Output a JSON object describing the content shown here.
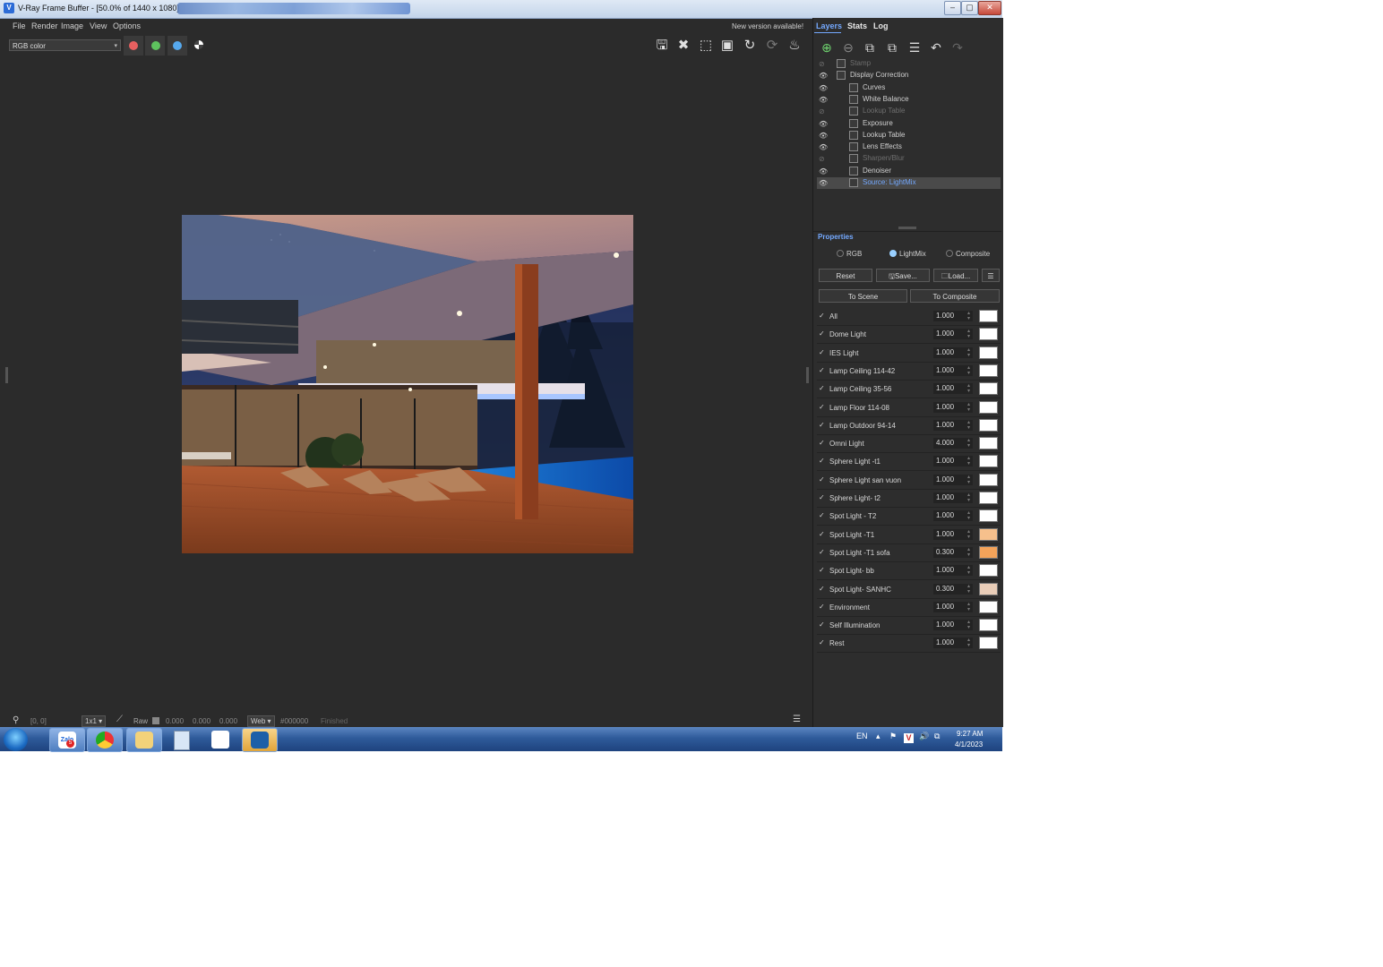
{
  "window": {
    "title": "V-Ray Frame Buffer - [50.0% of 1440 x 1080]",
    "controls": [
      "–",
      "▢",
      "✕"
    ]
  },
  "menu": [
    "File",
    "Render",
    "Image",
    "View",
    "Options"
  ],
  "notice": "New version available!",
  "toolbar": {
    "channel": "RGB color",
    "channel_colors": {
      "red": "#e86060",
      "green": "#5ec25e",
      "blue": "#56a9ee"
    }
  },
  "right_tabs": [
    "Layers",
    "Stats",
    "Log"
  ],
  "layers": [
    {
      "name": "Stamp",
      "indent": 0,
      "enabled": false,
      "selected": false
    },
    {
      "name": "Display Correction",
      "indent": 0,
      "enabled": true,
      "selected": false
    },
    {
      "name": "Curves",
      "indent": 1,
      "enabled": true,
      "selected": false
    },
    {
      "name": "White Balance",
      "indent": 1,
      "enabled": true,
      "selected": false
    },
    {
      "name": "Lookup Table",
      "indent": 1,
      "enabled": false,
      "selected": false
    },
    {
      "name": "Exposure",
      "indent": 1,
      "enabled": true,
      "selected": false
    },
    {
      "name": "Lookup Table",
      "indent": 1,
      "enabled": true,
      "selected": false
    },
    {
      "name": "Lens Effects",
      "indent": 1,
      "enabled": true,
      "selected": false
    },
    {
      "name": "Sharpen/Blur",
      "indent": 1,
      "enabled": false,
      "selected": false
    },
    {
      "name": "Denoiser",
      "indent": 1,
      "enabled": true,
      "selected": false
    },
    {
      "name": "Source: LightMix",
      "indent": 1,
      "enabled": true,
      "selected": true
    }
  ],
  "properties": {
    "title": "Properties",
    "modes": [
      {
        "label": "RGB",
        "on": false
      },
      {
        "label": "LightMix",
        "on": true
      },
      {
        "label": "Composite",
        "on": false
      }
    ],
    "buttons": {
      "reset": "Reset",
      "save": "Save...",
      "load": "Load...",
      "to_scene": "To Scene",
      "to_composite": "To Composite"
    }
  },
  "lights": [
    {
      "name": "All",
      "value": "1.000",
      "color": "#ffffff"
    },
    {
      "name": "Dome Light",
      "value": "1.000",
      "color": "#ffffff"
    },
    {
      "name": "IES Light",
      "value": "1.000",
      "color": "#ffffff"
    },
    {
      "name": "Lamp Ceiling 114-42",
      "value": "1.000",
      "color": "#ffffff"
    },
    {
      "name": "Lamp Ceiling 35-56",
      "value": "1.000",
      "color": "#ffffff"
    },
    {
      "name": "Lamp Floor 114-08",
      "value": "1.000",
      "color": "#ffffff"
    },
    {
      "name": "Lamp Outdoor 94-14",
      "value": "1.000",
      "color": "#ffffff"
    },
    {
      "name": "Omni Light",
      "value": "4.000",
      "color": "#ffffff"
    },
    {
      "name": "Sphere Light -t1",
      "value": "1.000",
      "color": "#ffffff"
    },
    {
      "name": "Sphere Light san vuon",
      "value": "1.000",
      "color": "#ffffff"
    },
    {
      "name": "Sphere Light- t2",
      "value": "1.000",
      "color": "#ffffff"
    },
    {
      "name": "Spot Light - T2",
      "value": "1.000",
      "color": "#ffffff"
    },
    {
      "name": "Spot Light -T1",
      "value": "1.000",
      "color": "#f6c08c"
    },
    {
      "name": "Spot Light -T1 sofa",
      "value": "0.300",
      "color": "#f3a35a"
    },
    {
      "name": "Spot Light- bb",
      "value": "1.000",
      "color": "#ffffff"
    },
    {
      "name": "Spot Light- SANHC",
      "value": "0.300",
      "color": "#e9cdb8"
    },
    {
      "name": "Environment",
      "value": "1.000",
      "color": "#ffffff"
    },
    {
      "name": "Self Illumination",
      "value": "1.000",
      "color": "#ffffff"
    },
    {
      "name": "Rest",
      "value": "1.000",
      "color": "#ffffff"
    }
  ],
  "status": {
    "coords": "[0, 0]",
    "zoom": "1x1",
    "raw": "Raw",
    "r": "0.000",
    "g": "0.000",
    "b": "0.000",
    "profile": "Web",
    "hex": "#000000",
    "state": "Finished"
  },
  "taskbar": {
    "lang": "EN",
    "time": "9:27 AM",
    "date": "4/1/2023",
    "zalo": "Zalo",
    "zalo_badge": "5"
  }
}
